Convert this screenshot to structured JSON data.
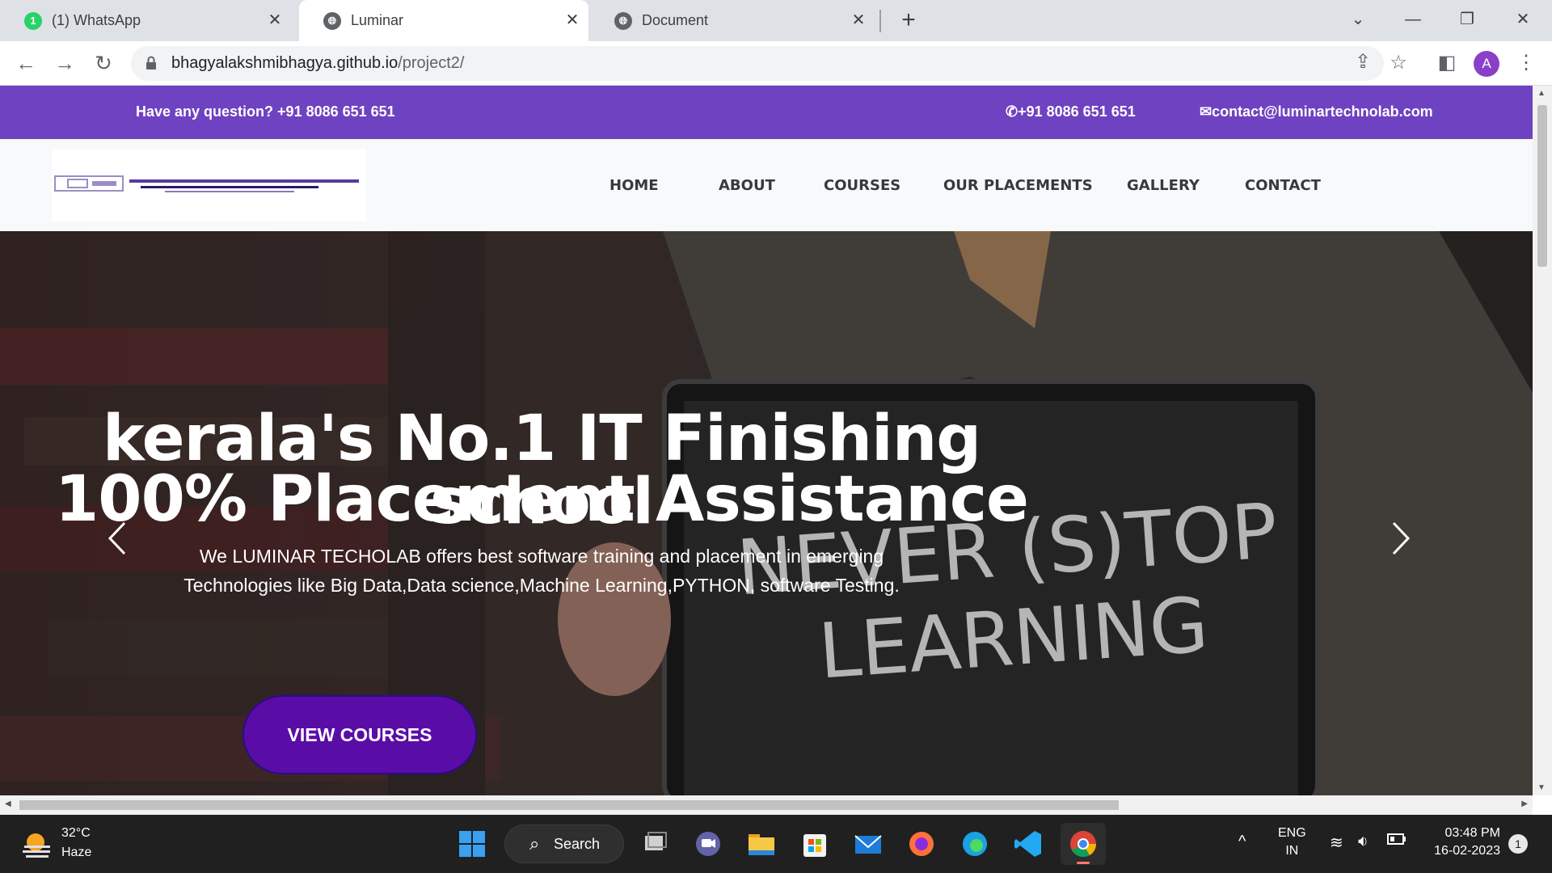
{
  "browser": {
    "tabs": [
      {
        "title": "(1) WhatsApp",
        "badge": "1"
      },
      {
        "title": "Luminar"
      },
      {
        "title": "Document"
      }
    ],
    "url_host": "bhagyalakshmibhagya.github.io",
    "url_path": "/project2/",
    "profile_initial": "A"
  },
  "site": {
    "topbar": {
      "question": "Have any question? +91 8086 651 651",
      "phone": "+91 8086 651 651",
      "email": "contact@luminartechnolab.com"
    },
    "nav": [
      "HOME",
      "ABOUT",
      "COURSES",
      "OUR PLACEMENTS",
      "GALLERY",
      "CONTACT"
    ],
    "hero": {
      "line1": "kerala's No.1 IT Finishing school",
      "line2": "100% Placement Assistance",
      "desc1": "We LUMINAR TECHOLAB offers best software training and placement in emerging",
      "desc2": "Technologies like Big Data,Data science,Machine Learning,PYTHON, software Testing.",
      "cta": "VIEW COURSES",
      "chalkboard": "NEVER (S)TOP LEARNING"
    },
    "accent": "#6f42c1",
    "cta_color": "#5a0da6"
  },
  "taskbar": {
    "temp": "32°C",
    "condition": "Haze",
    "search": "Search",
    "lang1": "ENG",
    "lang2": "IN",
    "time": "03:48 PM",
    "date": "16-02-2023",
    "notif": "1"
  }
}
